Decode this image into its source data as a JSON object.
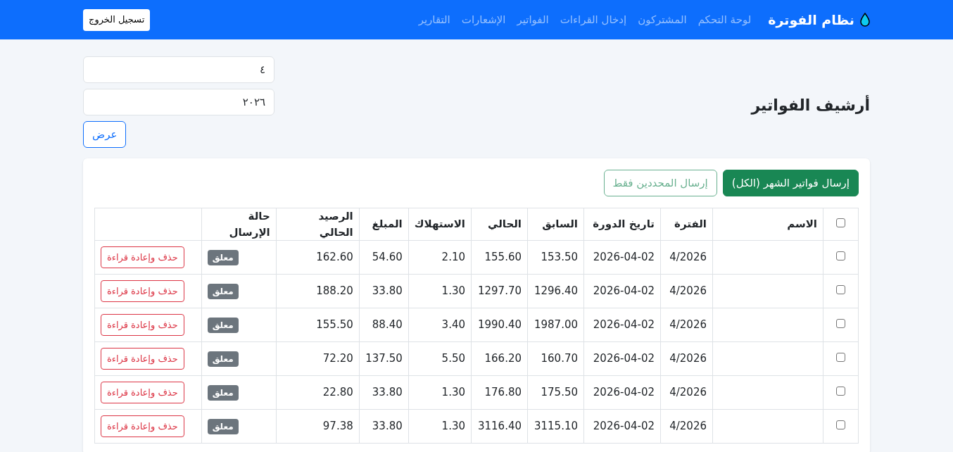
{
  "navbar": {
    "brand": "نظام الفوترة",
    "links": [
      "لوحة التحكم",
      "المشتركون",
      "إدخال القراءات",
      "الفواتير",
      "الإشعارات",
      "التقارير"
    ],
    "logout": "تسجيل الخروج"
  },
  "page": {
    "title": "أرشيف الفواتير",
    "month": "٤",
    "year": "٢٠٢٦",
    "show_button": "عرض"
  },
  "actions": [
    {
      "label": "إرسال فواتير الشهر (الكل)",
      "kind": "primary",
      "disabled": false
    },
    {
      "label": "إرسال المحددين فقط",
      "kind": "outline",
      "disabled": true
    }
  ],
  "table": {
    "select_all": {
      "checked": false
    },
    "columns": [
      "الاسم",
      "الفترة",
      "تاريخ الدورة",
      "السابق",
      "الحالي",
      "الاستهلاك",
      "المبلغ",
      "الرصيد الحالي",
      "حالة الإرسال"
    ],
    "rows": [
      {
        "checked": false,
        "name": "",
        "period": "4/2026",
        "date": "2026-04-02",
        "previous": "153.50",
        "current": "155.60",
        "consumption": "2.10",
        "amount": "54.60",
        "balance": "162.60",
        "status": "معلق",
        "action": "حذف وإعادة قراءة"
      },
      {
        "checked": false,
        "name": "",
        "period": "4/2026",
        "date": "2026-04-02",
        "previous": "1296.40",
        "current": "1297.70",
        "consumption": "1.30",
        "amount": "33.80",
        "balance": "188.20",
        "status": "معلق",
        "action": "حذف وإعادة قراءة"
      },
      {
        "checked": false,
        "name": "",
        "period": "4/2026",
        "date": "2026-04-02",
        "previous": "1987.00",
        "current": "1990.40",
        "consumption": "3.40",
        "amount": "88.40",
        "balance": "155.50",
        "status": "معلق",
        "action": "حذف وإعادة قراءة"
      },
      {
        "checked": false,
        "name": "",
        "period": "4/2026",
        "date": "2026-04-02",
        "previous": "160.70",
        "current": "166.20",
        "consumption": "5.50",
        "amount": "137.50",
        "balance": "72.20",
        "status": "معلق",
        "action": "حذف وإعادة قراءة"
      },
      {
        "checked": false,
        "name": "",
        "period": "4/2026",
        "date": "2026-04-02",
        "previous": "175.50",
        "current": "176.80",
        "consumption": "1.30",
        "amount": "33.80",
        "balance": "22.80",
        "status": "معلق",
        "action": "حذف وإعادة قراءة"
      },
      {
        "checked": false,
        "name": "",
        "period": "4/2026",
        "date": "2026-04-02",
        "previous": "3115.10",
        "current": "3116.40",
        "consumption": "1.30",
        "amount": "33.80",
        "balance": "97.38",
        "status": "معلق",
        "action": "حذف وإعادة قراءة"
      }
    ]
  }
}
